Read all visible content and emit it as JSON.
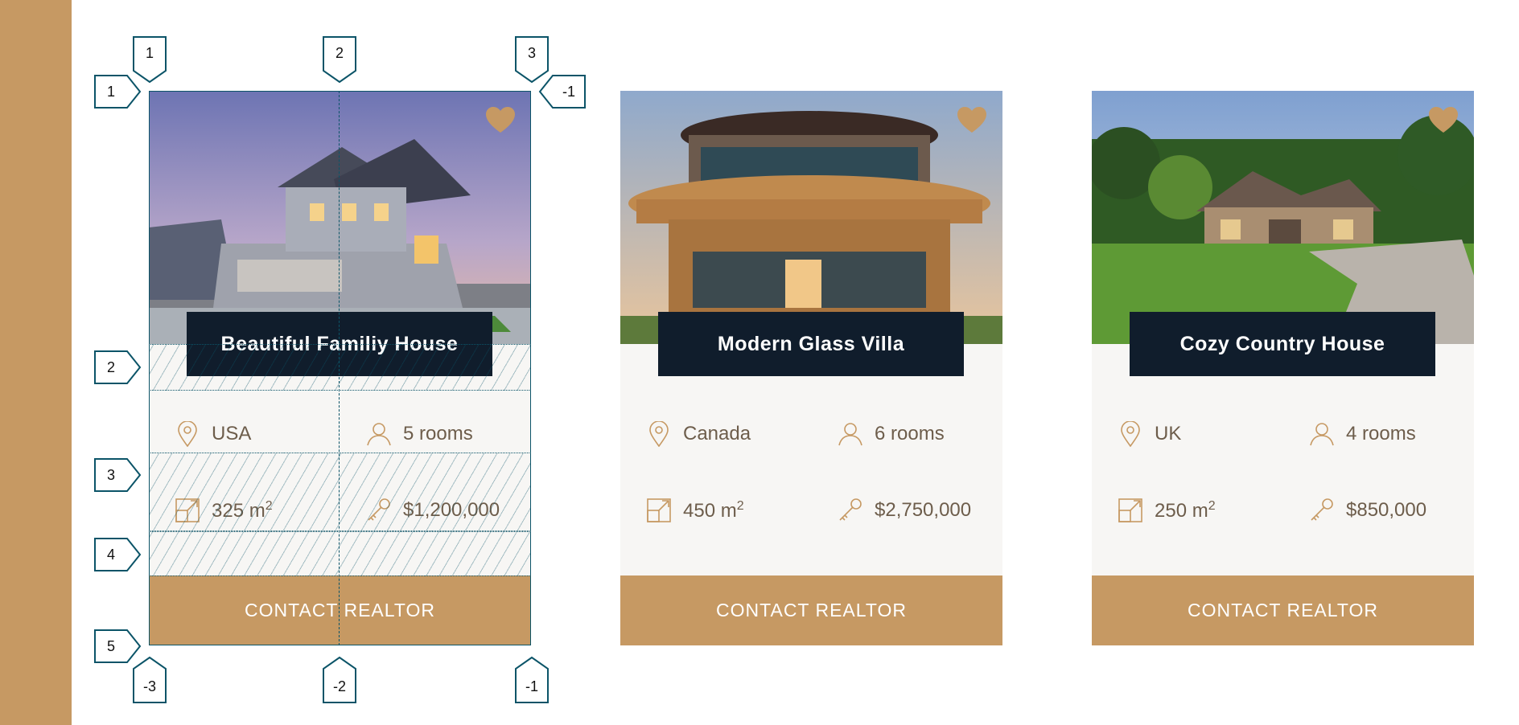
{
  "cards": [
    {
      "title": "Beautiful Familiy House",
      "location": "USA",
      "rooms": "5 rooms",
      "area": "325 m",
      "area_sup": "2",
      "price": "$1,200,000",
      "button": "CONTACT REALTOR"
    },
    {
      "title": "Modern Glass Villa",
      "location": "Canada",
      "rooms": "6 rooms",
      "area": "450 m",
      "area_sup": "2",
      "price": "$2,750,000",
      "button": "CONTACT REALTOR"
    },
    {
      "title": "Cozy Country House",
      "location": "UK",
      "rooms": "4 rooms",
      "area": "250 m",
      "area_sup": "2",
      "price": "$850,000",
      "button": "CONTACT REALTOR"
    }
  ],
  "grid_inspector": {
    "column_top": [
      "1",
      "2",
      "3"
    ],
    "column_bottom": [
      "-3",
      "-2",
      "-1"
    ],
    "row_left": [
      "1",
      "2",
      "3",
      "4",
      "5"
    ],
    "row_right": [
      "-1"
    ]
  },
  "colors": {
    "accent": "#c69963",
    "dark": "#101d2c",
    "card_bg": "#f7f6f4",
    "inspector": "#0b5468"
  },
  "icons": [
    "heart-icon",
    "map-pin-icon",
    "user-icon",
    "expand-icon",
    "key-icon"
  ]
}
